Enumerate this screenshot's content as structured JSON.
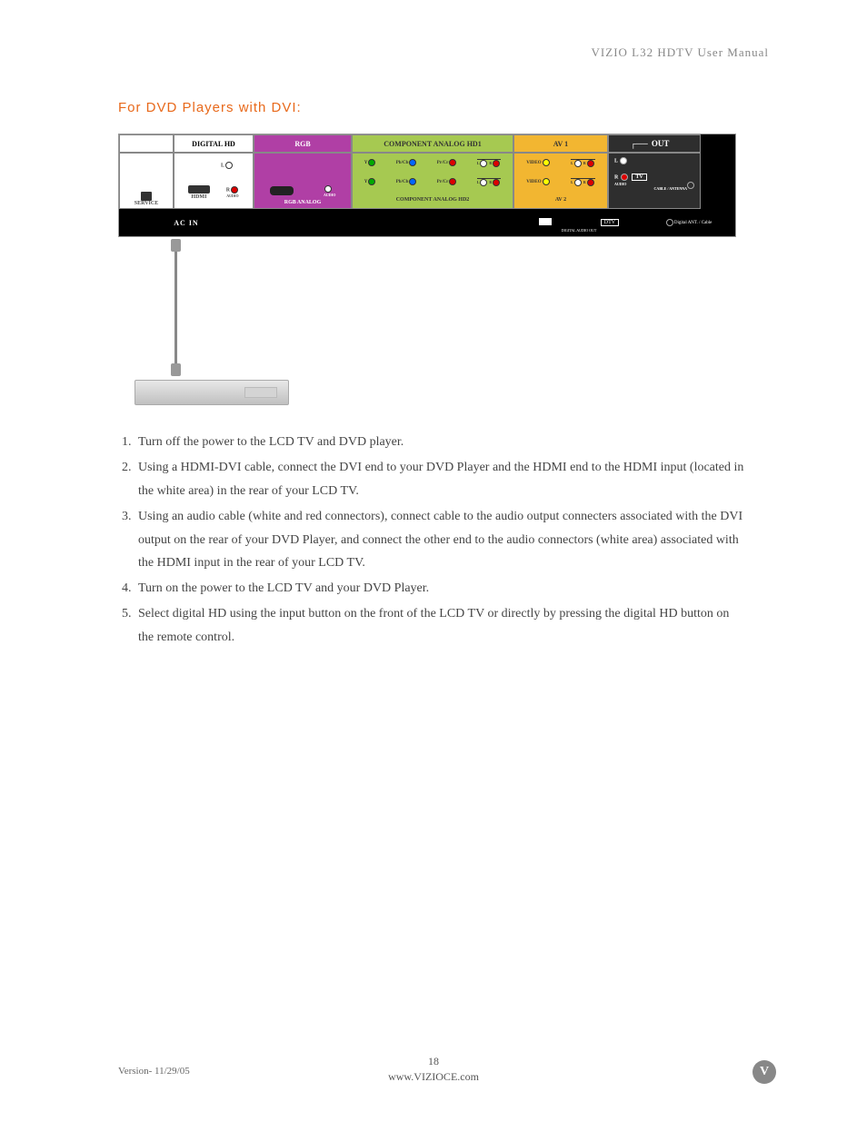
{
  "header": {
    "title": "VIZIO L32 HDTV User Manual"
  },
  "section": {
    "title": "For DVD Players with DVI:"
  },
  "panel": {
    "row1": {
      "digital_hd": "DIGITAL HD",
      "rgb": "RGB",
      "comp1": "COMPONENT ANALOG HD1",
      "av1": "AV 1",
      "out": "OUT"
    },
    "row2": {
      "service": "SERVICE",
      "hdmi": "HDMI",
      "audio": "AUDIO",
      "L": "L",
      "R": "R",
      "rgb_analog": "RGB ANALOG",
      "y": "Y",
      "pbcb": "Pb/Cb",
      "prcr": "Pr/Cr",
      "audio_lbl": "AUDIO",
      "comp2": "COMPONENT ANALOG HD2",
      "video": "VIDEO",
      "av2": "AV 2",
      "tv": "TV",
      "cable_ant": "CABLE / ANTENNA"
    },
    "row3": {
      "ac_in": "AC IN",
      "dtv": "DTV",
      "dig_audio": "DIGITAL AUDIO OUT",
      "ant": "Digital ANT. / Cable"
    }
  },
  "steps": [
    "Turn off the power to the LCD TV and DVD player.",
    "Using a HDMI-DVI cable, connect the DVI end to your DVD Player and the HDMI end to the HDMI input (located in the white area) in the rear of your LCD TV.",
    "Using an audio cable (white and red  connectors), connect cable to the audio output connecters associated with the DVI output on the rear of your DVD Player, and connect the other end to the audio connectors (white area) associated with the HDMI input in the rear of your LCD TV.",
    "Turn on the power to the LCD TV and your DVD Player.",
    "Select digital HD using the input button on the front of the LCD TV or directly by pressing the digital HD button on the remote control."
  ],
  "footer": {
    "page": "18",
    "url": "www.VIZIOCE.com",
    "version": "Version- 11/29/05",
    "logo": "V"
  }
}
